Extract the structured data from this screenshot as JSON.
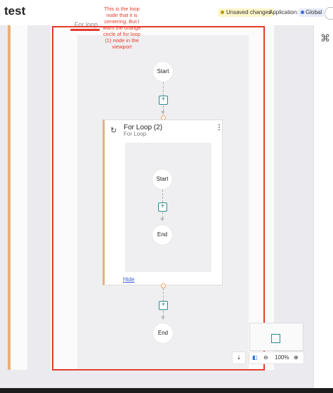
{
  "header": {
    "title": "test",
    "unsaved_label": "Unsaved changes",
    "application_label": "Application:",
    "application_value": "Global"
  },
  "annotation": {
    "note": "This is the loop node that it is centering. But I want the orange circle of for loop (1) node in the viewport",
    "color": "#e53b2c"
  },
  "outer_loop": {
    "label": "For loop"
  },
  "outer_flow": {
    "start_label": "Start",
    "end_label": "End"
  },
  "loop_card": {
    "title": "For Loop (2)",
    "subtitle": "For Loop",
    "inner_start_label": "Start",
    "inner_end_label": "End",
    "hide_label": "Hide"
  },
  "controls": {
    "zoom_value": "100%",
    "download_icon": "download-icon",
    "minimap_toggle_icon": "minimap-toggle-icon",
    "zoom_out_icon": "zoom-out-icon",
    "zoom_in_icon": "zoom-in-icon"
  },
  "colors": {
    "accent_orange": "#e8b07a",
    "plus_teal": "#2a8a8a",
    "link_blue": "#3a5fcf"
  }
}
